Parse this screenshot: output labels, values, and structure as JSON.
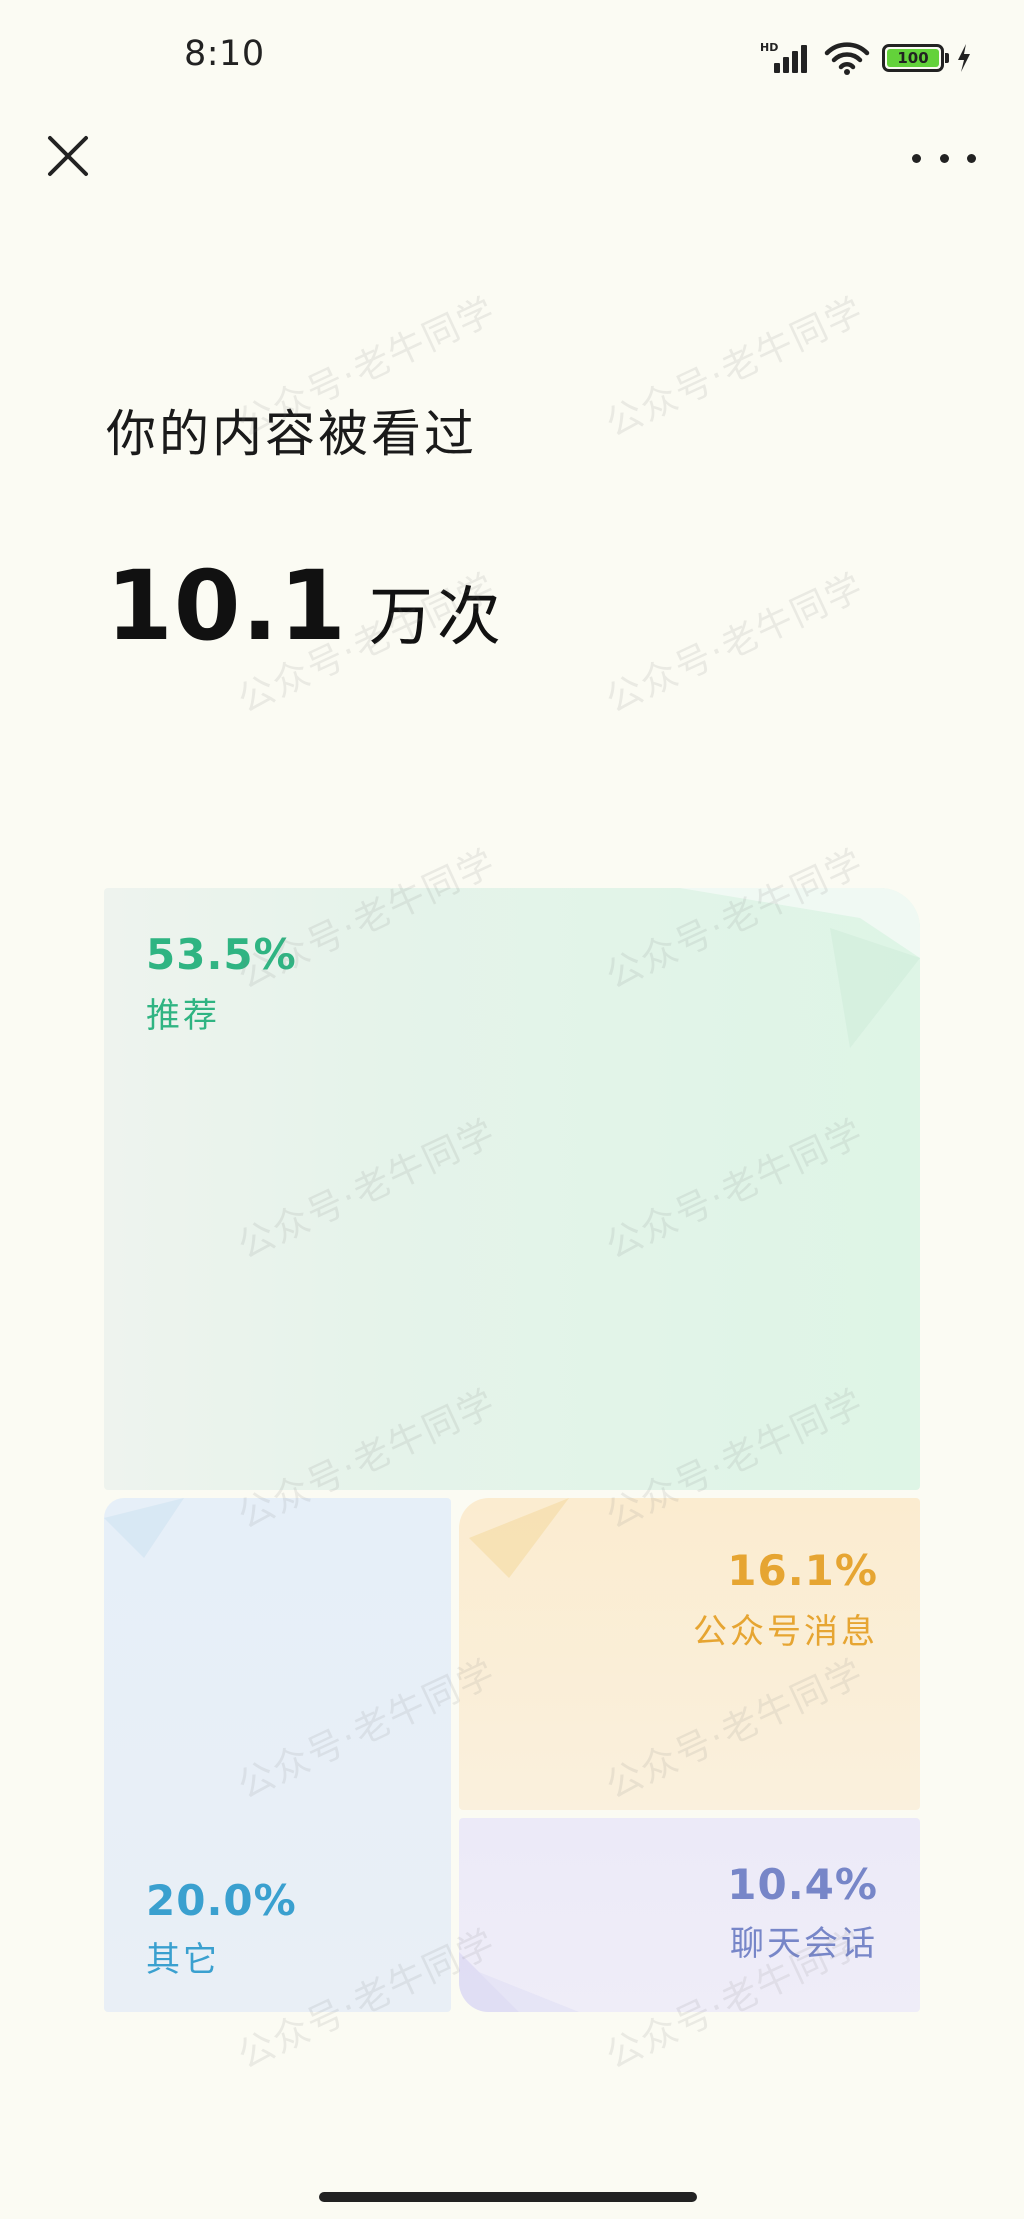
{
  "status_bar": {
    "time": "8:10",
    "network_label": "HD",
    "battery_level": "100",
    "icons": [
      "signal-icon",
      "wifi-icon",
      "battery-icon",
      "charging-icon"
    ]
  },
  "nav": {
    "close_icon": "close-icon",
    "more_icon": "more-icon"
  },
  "summary": {
    "headline": "你的内容被看过",
    "total_value": "10.1",
    "total_unit": "万次"
  },
  "sources": [
    {
      "key": "recommend",
      "percent": "53.5%",
      "label": "推荐",
      "share": 0.535,
      "color": "#2fb482"
    },
    {
      "key": "other",
      "percent": "20.0%",
      "label": "其它",
      "share": 0.2,
      "color": "#3aa0cf"
    },
    {
      "key": "official_account",
      "percent": "16.1%",
      "label": "公众号消息",
      "share": 0.161,
      "color": "#e6a532"
    },
    {
      "key": "chat",
      "percent": "10.4%",
      "label": "聊天会话",
      "share": 0.104,
      "color": "#7786c8"
    }
  ],
  "watermark": "公众号·老牛同学"
}
